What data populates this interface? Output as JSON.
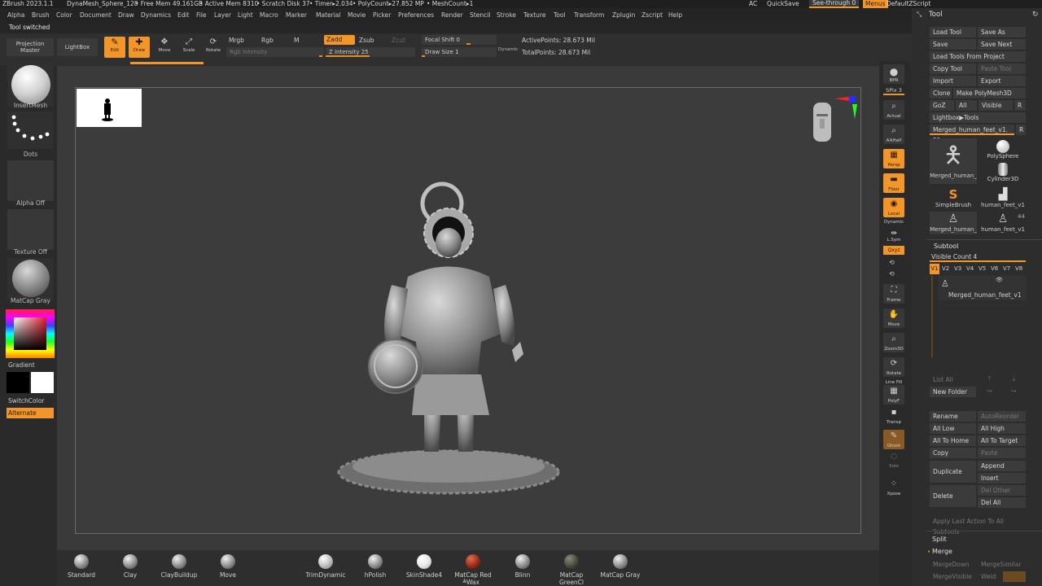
{
  "titlebar": {
    "app": "ZBrush 2023.1.1",
    "file": "DynaMesh_Sphere_128",
    "free_mem": "• Free Mem 49.161GB",
    "active_mem": "• Active Mem 8310",
    "scratch": "• Scratch Disk 37",
    "timer": "• Timer▸2.034",
    "polycount": "• PolyCount▸27.852 MP",
    "meshcount": "• MeshCount▸1",
    "ac": "AC",
    "quicksave": "QuickSave",
    "seethrough": "See-through  0",
    "menus": "Menus",
    "zscript": "DefaultZScript"
  },
  "menubar": [
    "Alpha",
    "Brush",
    "Color",
    "Document",
    "Draw",
    "Dynamics",
    "Edit",
    "File",
    "Layer",
    "Light",
    "Macro",
    "Marker",
    "Material",
    "Movie",
    "Picker",
    "Preferences",
    "Render",
    "Stencil",
    "Stroke",
    "Texture",
    "Tool",
    "Transform",
    "Zplugin",
    "Zscript",
    "Help"
  ],
  "notice": "Tool switched",
  "toolbar": {
    "projection_master": "Projection Master",
    "lightbox": "LightBox",
    "edit": "Edit",
    "draw": "Draw",
    "move": "Move",
    "scale": "Scale",
    "rotate": "Rotate",
    "mrgb": "Mrgb",
    "rgb": "Rgb",
    "m": "M",
    "rgb_intensity": "Rgb Intensity",
    "zadd": "Zadd",
    "zsub": "Zsub",
    "zcut": "Zcut",
    "z_intensity": "Z Intensity 25",
    "focal_shift": "Focal Shift 0",
    "draw_size": "Draw Size 1",
    "dynamic": "Dynamic",
    "active_points": "ActivePoints: 28.673 Mil",
    "total_points": "TotalPoints: 28.673 Mil"
  },
  "leftshelf": {
    "brush": "InsertMesh",
    "stroke": "Dots",
    "alpha": "Alpha Off",
    "texture": "Texture Off",
    "material": "MatCap Gray",
    "gradient": "Gradient",
    "switchcolor": "SwitchColor",
    "alternate": "Alternate"
  },
  "rightstrip": {
    "bpr": "BPR",
    "spix": "SPix 3",
    "actual": "Actual",
    "aahalf": "AAHalf",
    "persp": "Persp",
    "floor": "Floor",
    "local": "Local",
    "dynamic": "Dynamic",
    "lsym": "L.Sym",
    "xyz": "Qxyz",
    "frame": "Frame",
    "move": "Move",
    "zoom3d": "Zoom3D",
    "rotate": "Rotate",
    "linefill": "Line Fill",
    "polyf": "PolyF",
    "transp": "Transp",
    "ghost": "Ghost",
    "solo": "Solo",
    "xpose": "Xpose"
  },
  "rightpanel": {
    "title": "Tool",
    "load_tool": "Load Tool",
    "save_as": "Save As",
    "save": "Save",
    "save_next": "Save Next",
    "load_from_project": "Load Tools From Project",
    "copy_tool": "Copy Tool",
    "paste_tool": "Paste Tool",
    "import": "Import",
    "export": "Export",
    "clone": "Clone",
    "make_polymesh": "Make PolyMesh3D",
    "goz": "GoZ",
    "all": "All",
    "visible": "Visible",
    "r": "R",
    "lightbox_tools": "Lightbox▶Tools",
    "current_tool": "Merged_human_feet_v1. 51",
    "tools": [
      {
        "name": "Merged_human_"
      },
      {
        "name": "PolySphere"
      },
      {
        "name": "Cylinder3D"
      },
      {
        "name": "SimpleBrush"
      },
      {
        "name": "human_feet_v1"
      },
      {
        "name": "Merged_human_"
      },
      {
        "name": "human_feet_v1"
      }
    ],
    "tool_count": "44",
    "subtool": "Subtool",
    "visible_count": "Visible Count 4",
    "versions": [
      "V1",
      "V2",
      "V3",
      "V4",
      "V5",
      "V6",
      "V7",
      "V8"
    ],
    "subtool_item": "Merged_human_feet_v1",
    "list_all": "List All",
    "new_folder": "New Folder",
    "rename": "Rename",
    "autoreorder": "AutoReorder",
    "all_low": "All Low",
    "all_high": "All High",
    "all_to_home": "All To Home",
    "all_to_target": "All To Target",
    "copy": "Copy",
    "paste": "Paste",
    "duplicate": "Duplicate",
    "append": "Append",
    "insert": "Insert",
    "delete": "Delete",
    "del_other": "Del Other",
    "del_all": "Del All",
    "apply_last": "Apply Last Action To All Subtools",
    "split": "Split",
    "merge": "Merge",
    "merge_down": "MergeDown",
    "merge_similar": "MergeSimilar",
    "merge_visible": "MergeVisible",
    "weld": "Weld"
  },
  "bottomshelf": [
    "Standard",
    "Clay",
    "ClayBuildup",
    "Move",
    "TrimDynamic",
    "hPolish",
    "SkinShade4",
    "MatCap Red Wax",
    "Blinn",
    "MatCap GreenCl",
    "MatCap Gray"
  ],
  "colors": {
    "accent": "#f2962a",
    "panel": "#2d2d2d",
    "canvas": "#3c3c3c"
  }
}
